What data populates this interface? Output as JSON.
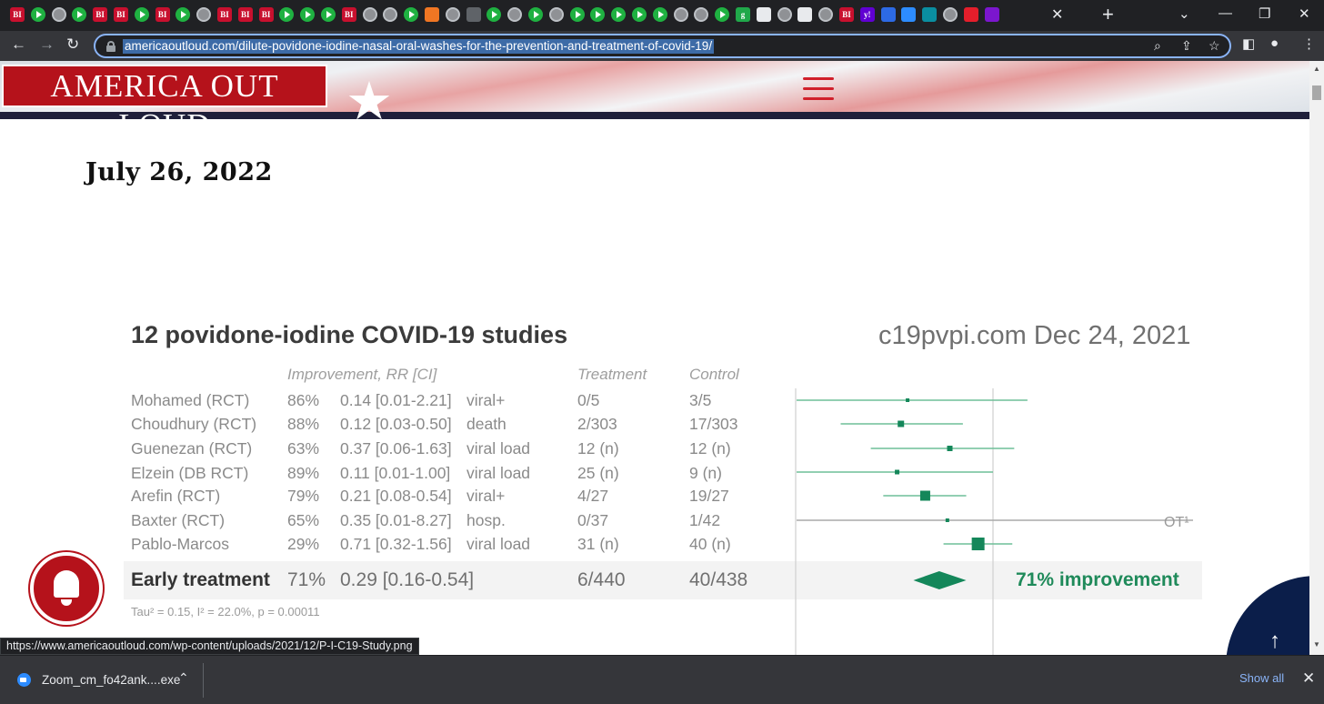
{
  "browser": {
    "url": "americaoutloud.com/dilute-povidone-iodine-nasal-oral-washes-for-the-prevention-and-treatment-of-covid-19/",
    "tab_favicons": [
      "bi",
      "play",
      "globe",
      "play",
      "bi",
      "bi",
      "play",
      "bi",
      "play",
      "globe",
      "bi",
      "bi",
      "bi",
      "play",
      "play",
      "play",
      "bi",
      "globe",
      "globe",
      "play",
      "orange",
      "globe",
      "gray",
      "play",
      "globe",
      "play",
      "globe",
      "play",
      "play",
      "play",
      "play",
      "play",
      "globe",
      "globe",
      "play",
      "g",
      "qr",
      "globe",
      "qr",
      "globe",
      "bi",
      "y",
      "blue",
      "zoom",
      "teal",
      "globe",
      "red",
      "purple"
    ],
    "new_tab_label": "+",
    "close_tab_label": "✕"
  },
  "site": {
    "logo_text": "AMERICA OUT LOUD",
    "date": "July 26, 2022"
  },
  "figure": {
    "title": "12 povidone-iodine COVID-19 studies",
    "source": "c19pvpi.com Dec 24, 2021",
    "col_improvement": "Improvement, RR [CI]",
    "col_treatment": "Treatment",
    "col_control": "Control",
    "rows": [
      {
        "study": "Mohamed (RCT)",
        "imp": "86%",
        "rr": "0.14 [0.01-2.21]",
        "outcome": "viral+",
        "treatment": "0/5",
        "control": "3/5"
      },
      {
        "study": "Choudhury (RCT)",
        "imp": "88%",
        "rr": "0.12 [0.03-0.50]",
        "outcome": "death",
        "treatment": "2/303",
        "control": "17/303"
      },
      {
        "study": "Guenezan (RCT)",
        "imp": "63%",
        "rr": "0.37 [0.06-1.63]",
        "outcome": "viral load",
        "treatment": "12 (n)",
        "control": "12 (n)"
      },
      {
        "study": "Elzein (DB RCT)",
        "imp": "89%",
        "rr": "0.11 [0.01-1.00]",
        "outcome": "viral load",
        "treatment": "25 (n)",
        "control": "9 (n)"
      },
      {
        "study": "Arefin (RCT)",
        "imp": "79%",
        "rr": "0.21 [0.08-0.54]",
        "outcome": "viral+",
        "treatment": "4/27",
        "control": "19/27"
      },
      {
        "study": "Baxter (RCT)",
        "imp": "65%",
        "rr": "0.35 [0.01-8.27]",
        "outcome": "hosp.",
        "treatment": "0/37",
        "control": "1/42"
      },
      {
        "study": "Pablo-Marcos",
        "imp": "29%",
        "rr": "0.71 [0.32-1.56]",
        "outcome": "viral load",
        "treatment": "31 (n)",
        "control": "40 (n)"
      }
    ],
    "summary": {
      "label": "Early treatment",
      "imp": "71%",
      "rr": "0.29 [0.16-0.54]",
      "treatment": "6/440",
      "control": "40/438",
      "improvement_text": "71% improvement"
    },
    "tau_text": "Tau² = 0.15, I² = 22.0%, p = 0.00011",
    "ot_label": "OT¹"
  },
  "chart_data": {
    "type": "forest",
    "studies": [
      {
        "name": "Mohamed (RCT)",
        "rr": 0.14,
        "low": 0.01,
        "high": 2.21
      },
      {
        "name": "Choudhury (RCT)",
        "rr": 0.12,
        "low": 0.03,
        "high": 0.5
      },
      {
        "name": "Guenezan (RCT)",
        "rr": 0.37,
        "low": 0.06,
        "high": 1.63
      },
      {
        "name": "Elzein (DB RCT)",
        "rr": 0.11,
        "low": 0.01,
        "high": 1.0
      },
      {
        "name": "Arefin (RCT)",
        "rr": 0.21,
        "low": 0.08,
        "high": 0.54
      },
      {
        "name": "Baxter (RCT)",
        "rr": 0.35,
        "low": 0.01,
        "high": 8.27
      },
      {
        "name": "Pablo-Marcos",
        "rr": 0.71,
        "low": 0.32,
        "high": 1.56
      }
    ],
    "summary": {
      "rr": 0.29,
      "low": 0.16,
      "high": 0.54
    },
    "color": "#14875a"
  },
  "status": {
    "hover_url": "https://www.americaoutloud.com/wp-content/uploads/2021/12/P-I-C19-Study.png"
  },
  "downloads": {
    "file_name": "Zoom_cm_fo42ank....exe",
    "show_all": "Show all"
  }
}
